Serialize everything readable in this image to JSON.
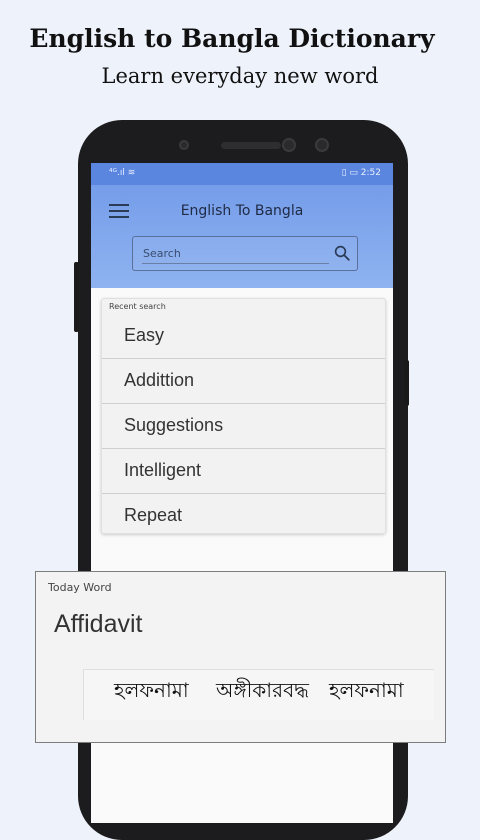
{
  "promo": {
    "title": "English to Bangla Dictionary",
    "subtitle": "Learn everyday new word"
  },
  "status_bar": {
    "time": "2:52",
    "left_icons": "⁴ᴳ.ıl ≋",
    "right_icons": "▯ ▭ "
  },
  "app_bar": {
    "title": "English To Bangla",
    "menu_icon": "hamburger-menu-icon"
  },
  "search": {
    "placeholder": "Search",
    "icon": "search-icon"
  },
  "recent": {
    "label": "Recent search",
    "items": [
      "Easy",
      "Addittion",
      "Suggestions",
      "Intelligent",
      "Repeat"
    ]
  },
  "today": {
    "label": "Today Word",
    "word": "Affidavit",
    "meanings": [
      "হলফনামা",
      "অঙ্গীকারবদ্ধ",
      "হলফনামা"
    ]
  },
  "colors": {
    "header_gradient_top": "#6f98e8",
    "header_gradient_bottom": "#8fb3f0",
    "page_background": "#eef3fb"
  }
}
